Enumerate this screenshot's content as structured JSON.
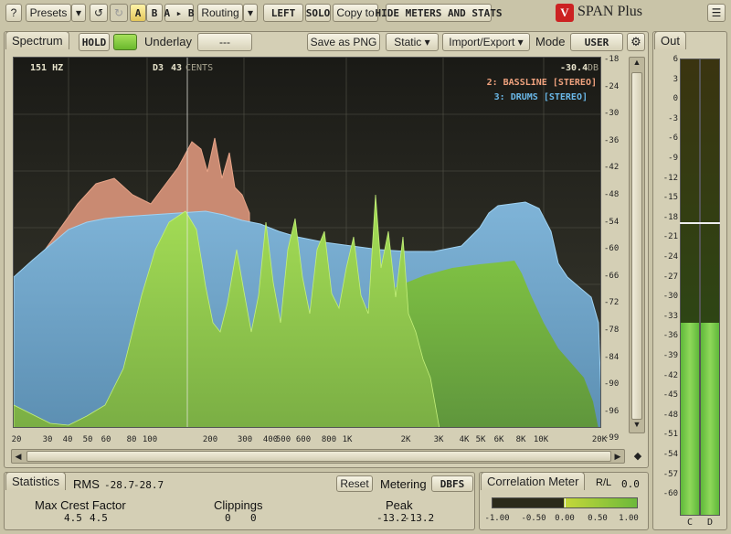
{
  "toolbar": {
    "help_label": "?",
    "presets_label": "Presets",
    "ab_a_label": "A",
    "ab_b_label": "B",
    "ab_copy_label": "A ▸ B",
    "routing_label": "Routing",
    "left_label": "LEFT",
    "solo_label": "SOLO",
    "copy_to_label": "Copy to",
    "hide_meters_label": "HIDE METERS AND STATS",
    "brand_badge": "V",
    "app_title": "SPAN Plus"
  },
  "spectrum": {
    "tab_label": "Spectrum",
    "hold_label": "HOLD",
    "underlay_label": "Underlay",
    "underlay_value": "---",
    "save_png_label": "Save as PNG",
    "static_label": "Static",
    "import_export_label": "Import/Export",
    "mode_label": "Mode",
    "mode_value": "USER",
    "cursor_freq": "151 HZ",
    "cursor_note": "D3",
    "cursor_cents": "43",
    "cursor_cents_unit": "CENTS",
    "cursor_db": "-30.4",
    "cursor_db_unit": "DB",
    "legend": [
      {
        "label": "2: BASSLINE [STEREO]",
        "color": "#f0a27e"
      },
      {
        "label": "3: DRUMS [STEREO]",
        "color": "#6ab8e8"
      }
    ],
    "y_ticks": [
      "-18",
      "-24",
      "-30",
      "-36",
      "-42",
      "-48",
      "-54",
      "-60",
      "-66",
      "-72",
      "-78",
      "-84",
      "-90",
      "-96",
      "-99"
    ],
    "x_ticks": [
      "20",
      "30",
      "40",
      "50",
      "60",
      "80",
      "100",
      "200",
      "300",
      "400",
      "500",
      "600",
      "800",
      "1K",
      "2K",
      "3K",
      "4K",
      "5K",
      "6K",
      "8K",
      "10K",
      "20K"
    ]
  },
  "out_meter": {
    "tab_label": "Out",
    "ticks": [
      "6",
      "3",
      "0",
      "-3",
      "-6",
      "-9",
      "-12",
      "-15",
      "-18",
      "-21",
      "-24",
      "-27",
      "-30",
      "-33",
      "-36",
      "-39",
      "-42",
      "-45",
      "-48",
      "-51",
      "-54",
      "-57",
      "-60"
    ],
    "channel_left": "C",
    "channel_right": "D"
  },
  "statistics": {
    "tab_label": "Statistics",
    "rms_label": "RMS",
    "rms_left": "-28.7",
    "rms_right": "-28.7",
    "reset_label": "Reset",
    "metering_label": "Metering",
    "metering_value": "DBFS",
    "crest_label": "Max Crest Factor",
    "crest_left": "4.5",
    "crest_right": "4.5",
    "clippings_label": "Clippings",
    "clip_left": "0",
    "clip_right": "0",
    "peak_label": "Peak",
    "peak_left": "-13.2",
    "peak_right": "-13.2"
  },
  "correlation": {
    "tab_label": "Correlation Meter",
    "rl_label": "R/L",
    "rl_value": "0.0",
    "ticks": [
      "-1.00",
      "-0.50",
      "0.00",
      "0.50",
      "1.00"
    ]
  },
  "colors": {
    "accent_green": "#7ec832",
    "bassline": "#f0a27e",
    "drums": "#6ab8e8",
    "main_track": "#8fce4a"
  }
}
